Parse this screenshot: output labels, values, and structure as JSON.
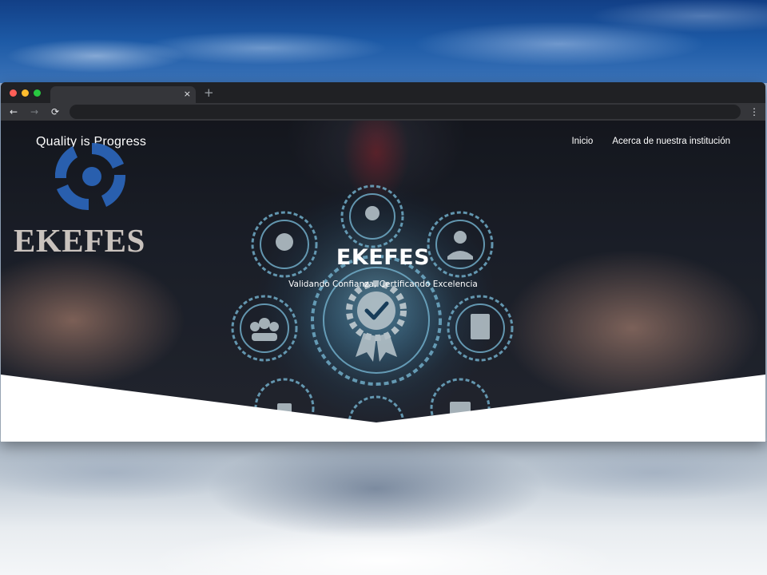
{
  "browser": {
    "tab_close_glyph": "×",
    "new_tab_glyph": "+",
    "back_glyph": "←",
    "forward_glyph": "→",
    "reload_glyph": "⟳",
    "menu_glyph": "⋮"
  },
  "site": {
    "brand_tagline": "Quality is Progress",
    "logo_text": "EKEFES",
    "nav": [
      {
        "label": "Inicio"
      },
      {
        "label": "Acerca de nuestra institución"
      }
    ]
  },
  "hero": {
    "title": "EKEFES",
    "subtitle": "Validando Confianza, Certificando Excelencia"
  },
  "colors": {
    "logo_blue": "#2a63b6",
    "divider_white": "#ffffff",
    "glow_cyan": "#7fd6ff"
  }
}
